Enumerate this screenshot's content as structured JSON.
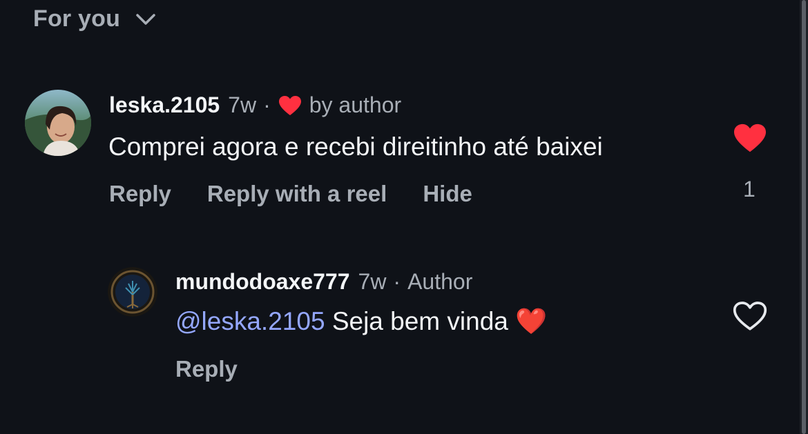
{
  "sort": {
    "label": "For you",
    "icon": "chevron-down-icon"
  },
  "comments": [
    {
      "username": "leska.2105",
      "age": "7w",
      "separator": "·",
      "liked_by_author_label": "by author",
      "text": "Comprei agora e recebi direitinho até baixei",
      "actions": [
        "Reply",
        "Reply with a reel",
        "Hide"
      ],
      "like_count": "1",
      "liked": true
    },
    {
      "username": "mundodoaxe777",
      "age": "7w",
      "separator": "·",
      "author_badge": "Author",
      "mention": "@leska.2105",
      "text": "Seja bem vinda",
      "emoji": "❤️",
      "actions": [
        "Reply"
      ],
      "liked": false
    }
  ],
  "colors": {
    "background": "#0f1218",
    "like_red": "#ff3040",
    "mention_blue": "#94a7ff",
    "secondary_text": "#a8aeb6"
  }
}
